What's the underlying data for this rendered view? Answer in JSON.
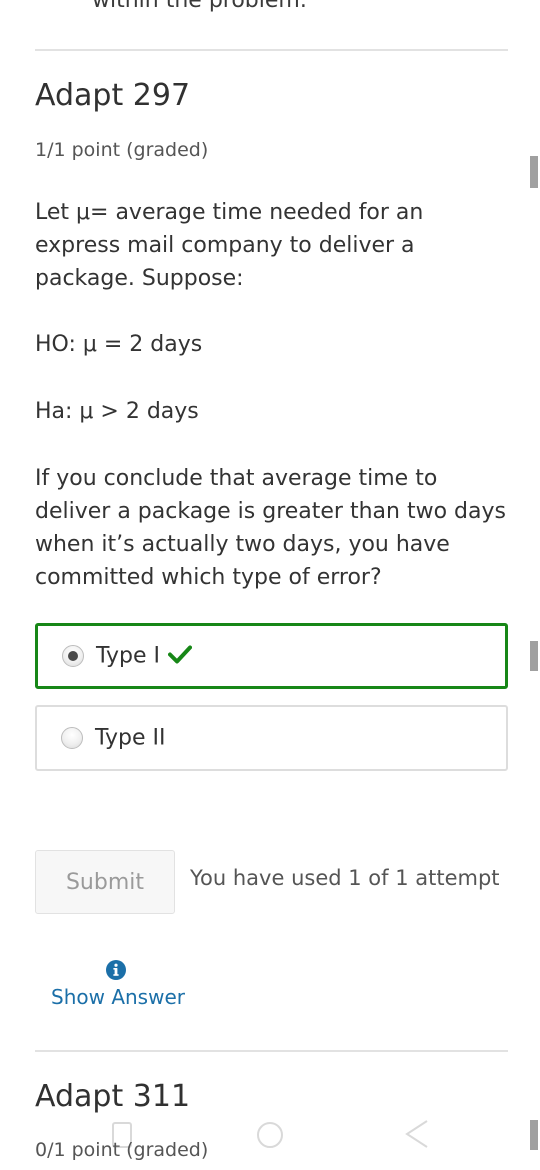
{
  "top_clipped_text": "within the problem.",
  "problem1": {
    "title": "Adapt 297",
    "points": "1/1 point (graded)",
    "intro": "Let μ= average time needed for an express mail company to deliver a package. Suppose:",
    "h0": "HO: μ = 2 days",
    "ha": "Ha: μ > 2 days",
    "question": "If you conclude that average time to deliver a package is greater than two days when it’s actually two days, you have committed which type of error?",
    "choices": [
      {
        "label": "Type I",
        "selected": true,
        "correct": true
      },
      {
        "label": "Type II",
        "selected": false,
        "correct": false
      }
    ],
    "submit_label": "Submit",
    "attempts_text": "You have used 1 of 1 attempt",
    "show_answer_label": "Show Answer",
    "colors": {
      "correct_border": "#178717",
      "link": "#1b6fa8"
    }
  },
  "problem2": {
    "title": "Adapt 311",
    "points": "0/1 point (graded)"
  }
}
